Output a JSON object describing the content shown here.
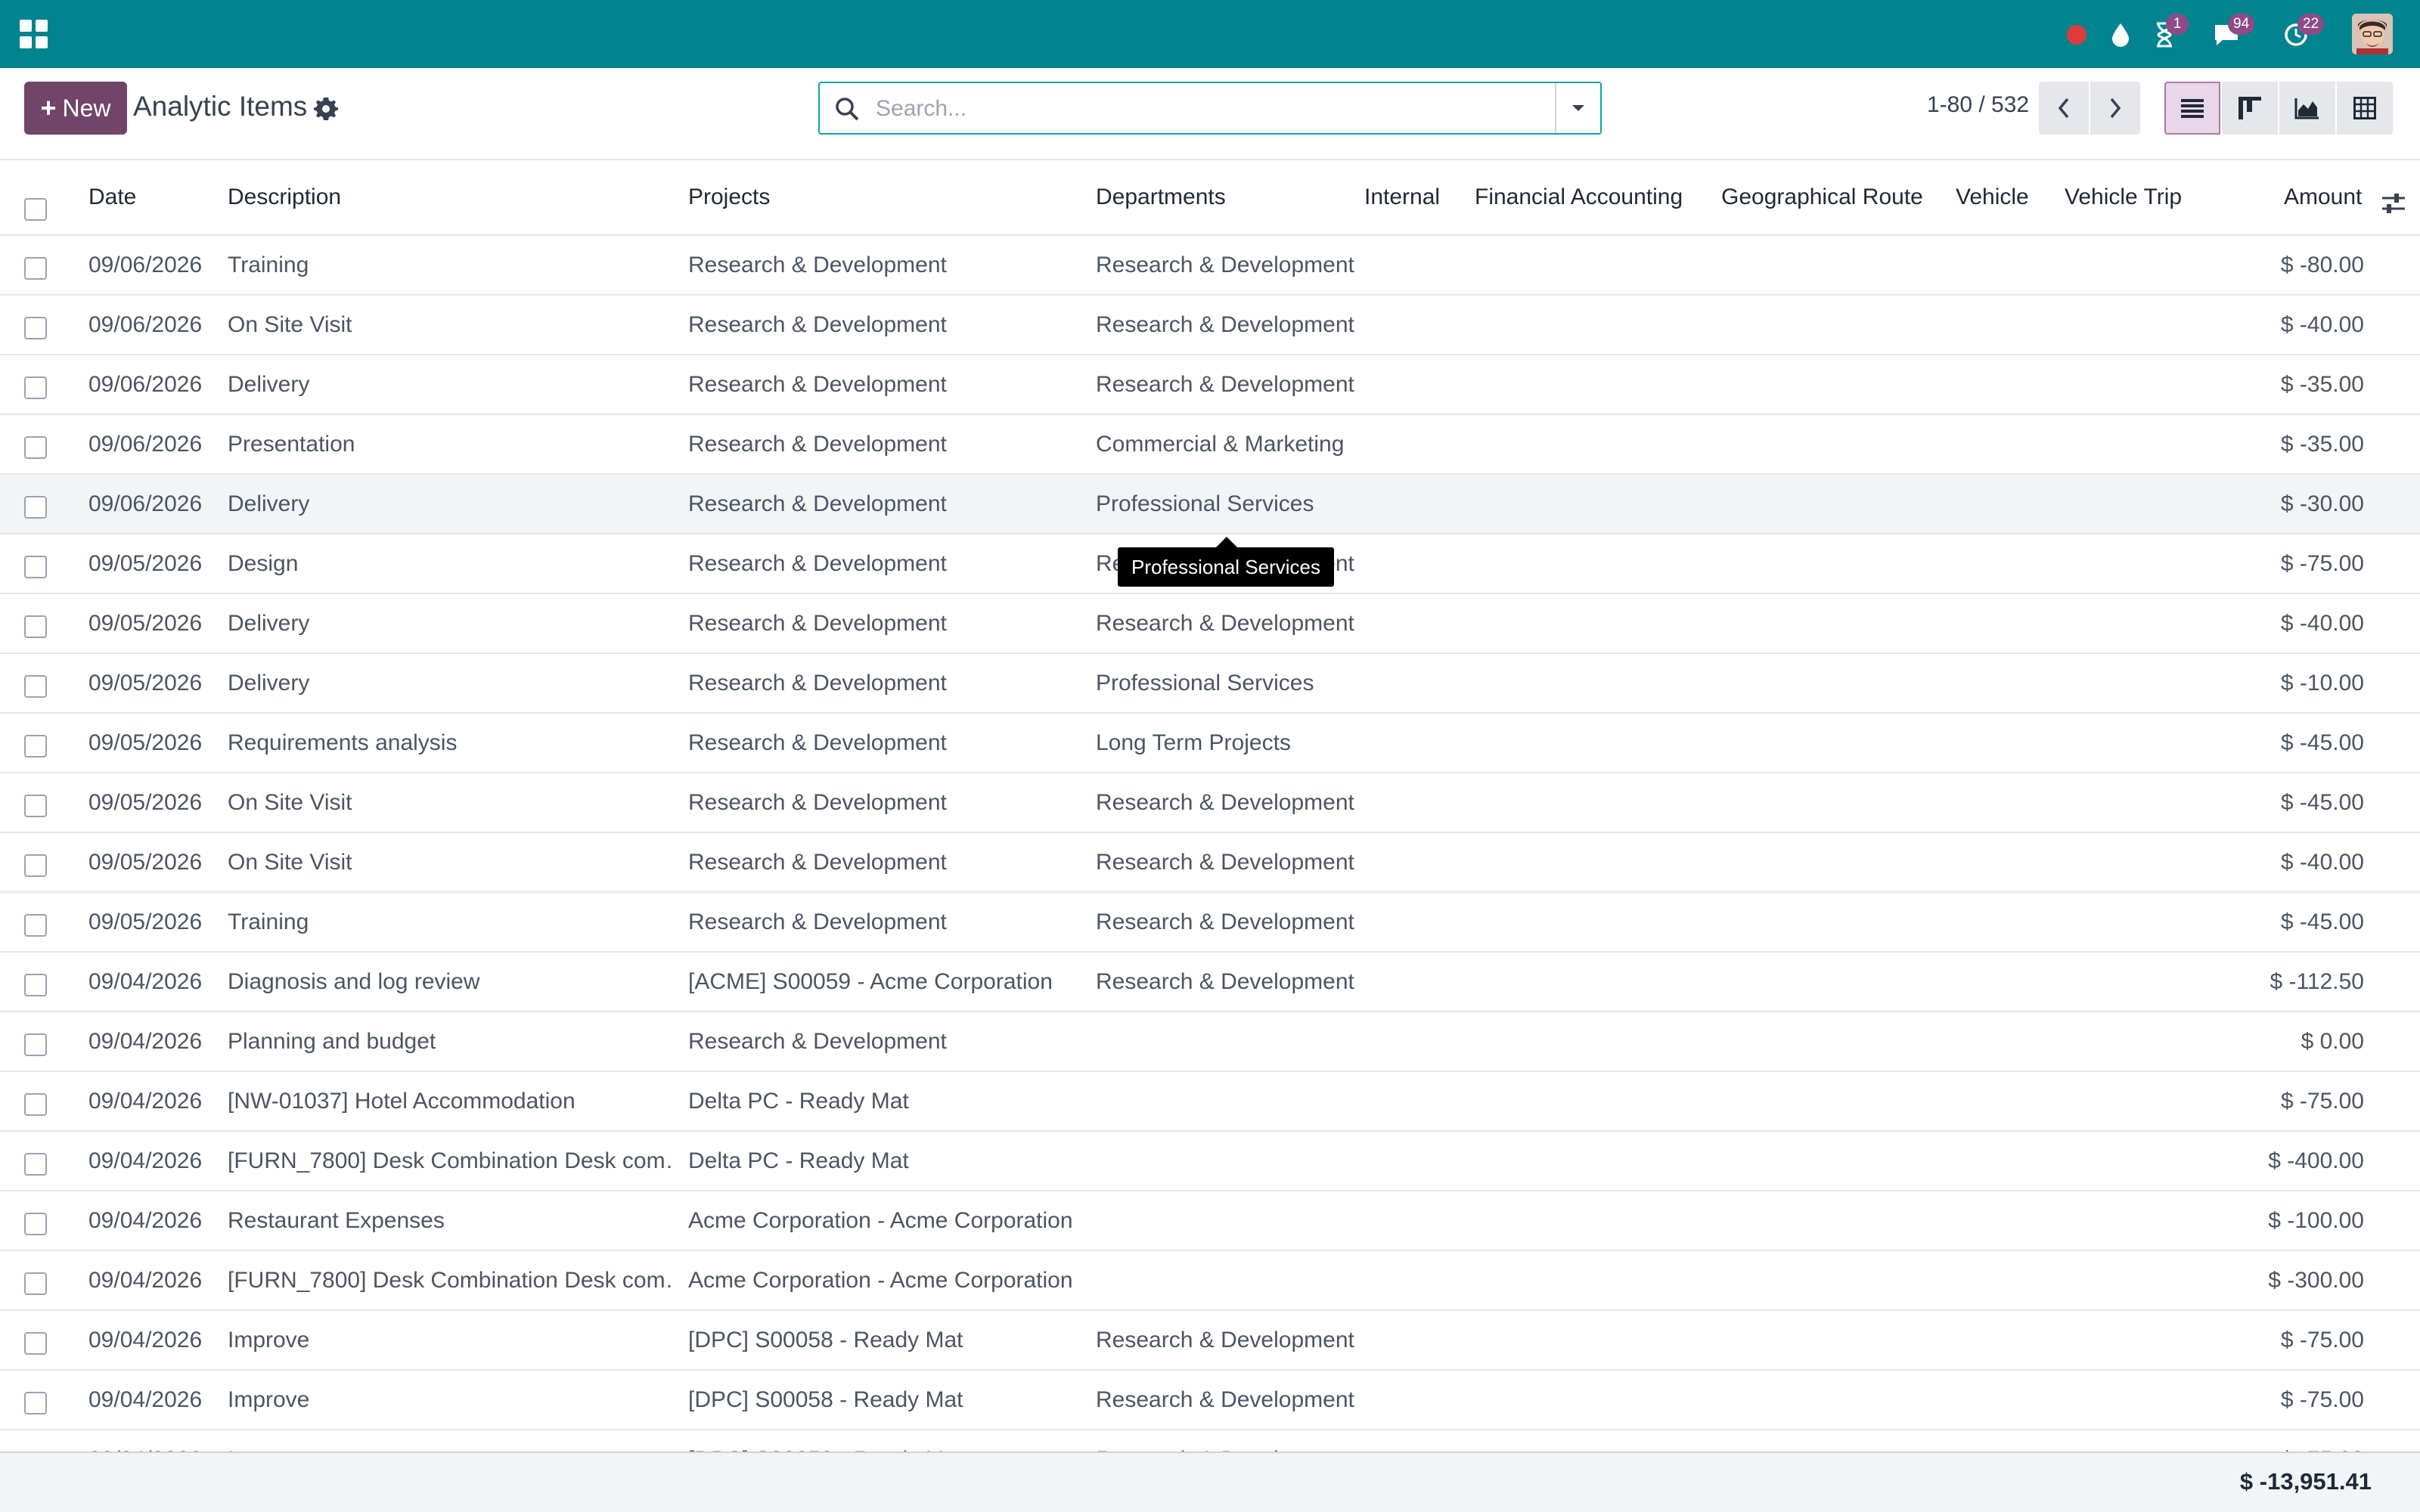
{
  "navbar": {
    "apps_icon": "apps-grid-icon",
    "systray": [
      {
        "name": "recording-indicator",
        "icon": "red-dot-icon",
        "badge": null
      },
      {
        "name": "drop-icon",
        "icon": "drop-icon",
        "badge": null
      },
      {
        "name": "activity-icon",
        "icon": "hourglass-icon",
        "badge": "1"
      },
      {
        "name": "messages-icon",
        "icon": "chat-icon",
        "badge": "94"
      },
      {
        "name": "timer-icon",
        "icon": "clock-icon",
        "badge": "22"
      }
    ],
    "brand_color": "#01848f"
  },
  "control": {
    "new_label": "New",
    "title": "Analytic Items",
    "search_placeholder": "Search...",
    "pager": "1-80 / 532",
    "views": [
      "list-view",
      "kanban-view",
      "graph-view",
      "pivot-view"
    ],
    "active_view": "list-view"
  },
  "table": {
    "columns": [
      "Date",
      "Description",
      "Projects",
      "Departments",
      "Internal",
      "Financial Accounting",
      "Geographical Route",
      "Vehicle",
      "Vehicle Trip",
      "Amount"
    ],
    "rows": [
      {
        "date": "09/06/2026",
        "description": "Training",
        "project": "Research & Development",
        "department": "Research & Development",
        "amount": "$ -80.00"
      },
      {
        "date": "09/06/2026",
        "description": "On Site Visit",
        "project": "Research & Development",
        "department": "Research & Development",
        "amount": "$ -40.00"
      },
      {
        "date": "09/06/2026",
        "description": "Delivery",
        "project": "Research & Development",
        "department": "Research & Development",
        "amount": "$ -35.00"
      },
      {
        "date": "09/06/2026",
        "description": "Presentation",
        "project": "Research & Development",
        "department": "Commercial & Marketing",
        "amount": "$ -35.00"
      },
      {
        "date": "09/06/2026",
        "description": "Delivery",
        "project": "Research & Development",
        "department": "Professional Services",
        "amount": "$ -30.00"
      },
      {
        "date": "09/05/2026",
        "description": "Design",
        "project": "Research & Development",
        "department": "Research & Development",
        "amount": "$ -75.00"
      },
      {
        "date": "09/05/2026",
        "description": "Delivery",
        "project": "Research & Development",
        "department": "Research & Development",
        "amount": "$ -40.00"
      },
      {
        "date": "09/05/2026",
        "description": "Delivery",
        "project": "Research & Development",
        "department": "Professional Services",
        "amount": "$ -10.00"
      },
      {
        "date": "09/05/2026",
        "description": "Requirements analysis",
        "project": "Research & Development",
        "department": "Long Term Projects",
        "amount": "$ -45.00"
      },
      {
        "date": "09/05/2026",
        "description": "On Site Visit",
        "project": "Research & Development",
        "department": "Research & Development",
        "amount": "$ -45.00"
      },
      {
        "date": "09/05/2026",
        "description": "On Site Visit",
        "project": "Research & Development",
        "department": "Research & Development",
        "amount": "$ -40.00"
      },
      {
        "date": "09/05/2026",
        "description": "Training",
        "project": "Research & Development",
        "department": "Research & Development",
        "amount": "$ -45.00"
      },
      {
        "date": "09/04/2026",
        "description": "Diagnosis and log review",
        "project": "[ACME] S00059 - Acme Corporation",
        "department": "Research & Development",
        "amount": "$ -112.50"
      },
      {
        "date": "09/04/2026",
        "description": "Planning and budget",
        "project": "Research & Development",
        "department": "",
        "amount": "$ 0.00"
      },
      {
        "date": "09/04/2026",
        "description": "[NW-01037] Hotel Accommodation",
        "project": "Delta PC - Ready Mat",
        "department": "",
        "amount": "$ -75.00"
      },
      {
        "date": "09/04/2026",
        "description": "[FURN_7800] Desk Combination Desk com…",
        "project": "Delta PC - Ready Mat",
        "department": "",
        "amount": "$ -400.00"
      },
      {
        "date": "09/04/2026",
        "description": "Restaurant Expenses",
        "project": "Acme Corporation - Acme Corporation",
        "department": "",
        "amount": "$ -100.00"
      },
      {
        "date": "09/04/2026",
        "description": "[FURN_7800] Desk Combination Desk com…",
        "project": "Acme Corporation - Acme Corporation",
        "department": "",
        "amount": "$ -300.00"
      },
      {
        "date": "09/04/2026",
        "description": "Improve",
        "project": "[DPC] S00058 - Ready Mat",
        "department": "Research & Development",
        "amount": "$ -75.00"
      },
      {
        "date": "09/04/2026",
        "description": "Improve",
        "project": "[DPC] S00058 - Ready Mat",
        "department": "Research & Development",
        "amount": "$ -75.00"
      }
    ],
    "total": "$ -13,951.41"
  },
  "tooltip": {
    "text": "Professional Services"
  }
}
